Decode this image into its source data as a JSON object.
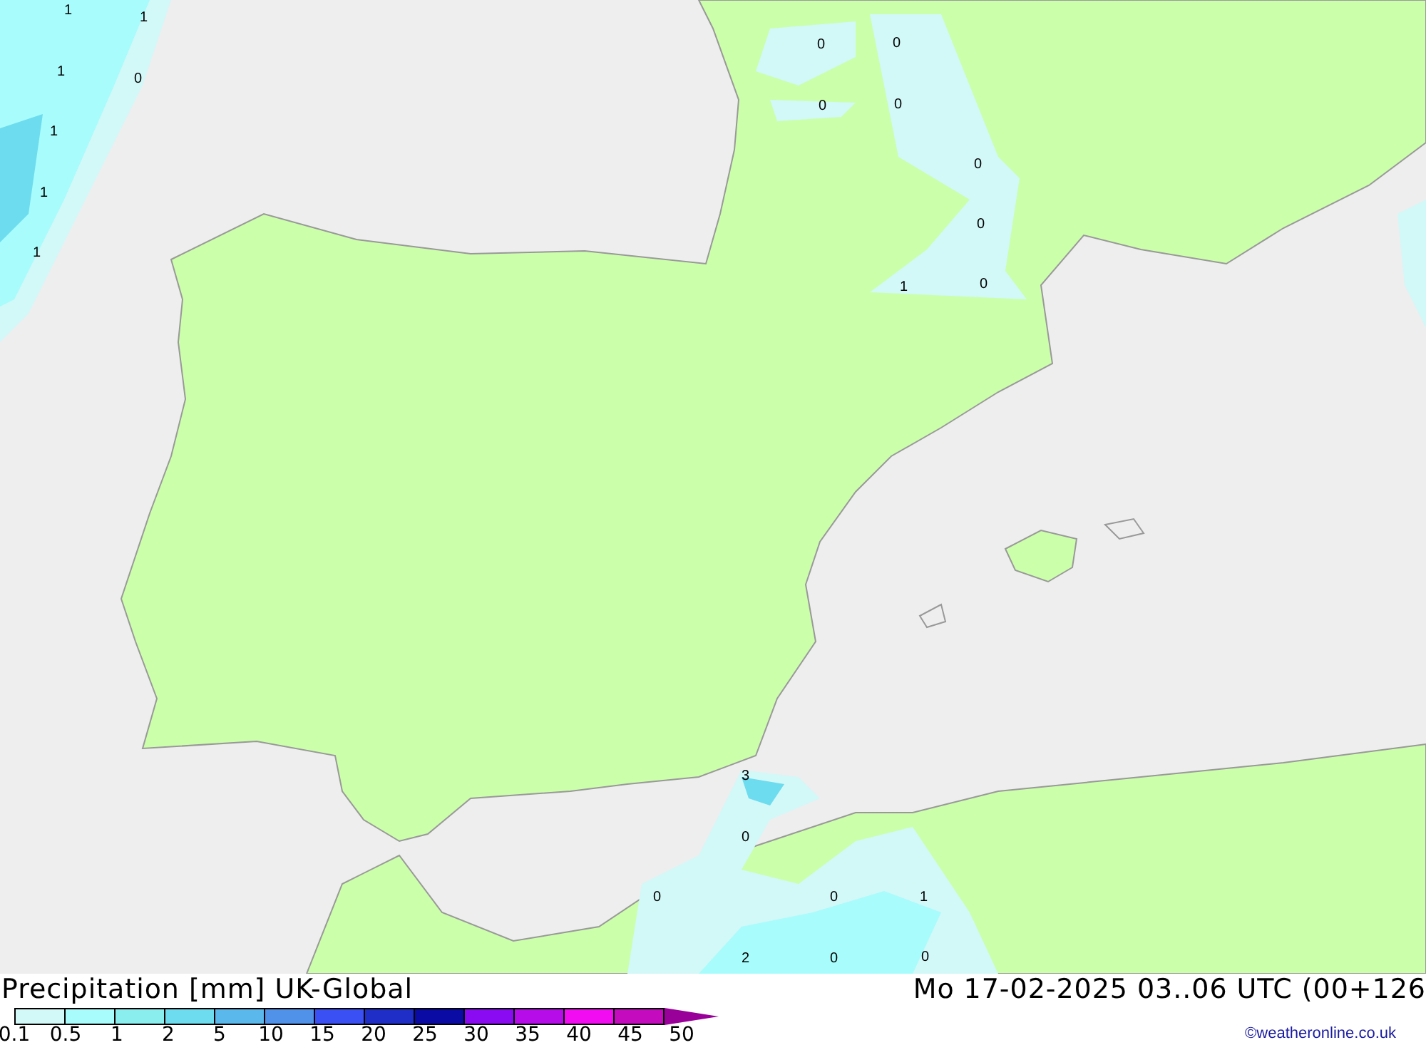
{
  "map": {
    "value_labels": [
      "1",
      "1",
      "1",
      "0",
      "1",
      "1",
      "1",
      "0",
      "0",
      "0",
      "0",
      "0",
      "0",
      "1",
      "0",
      "3",
      "0",
      "0",
      "0",
      "1",
      "2",
      "0",
      "0"
    ]
  },
  "footer": {
    "title": "Precipitation [mm] UK-Global",
    "valid_time": "Mo 17-02-2025 03..06 UTC (00+126",
    "copyright": "©weatheronline.co.uk"
  },
  "legend": {
    "swatches": [
      {
        "color": "#d2f8f8"
      },
      {
        "color": "#a8fcfc"
      },
      {
        "color": "#8aeeee"
      },
      {
        "color": "#6cdcee"
      },
      {
        "color": "#5ab8ec"
      },
      {
        "color": "#5092ea"
      },
      {
        "color": "#3a50f4"
      },
      {
        "color": "#1e2ec6"
      },
      {
        "color": "#0a0aa4"
      },
      {
        "color": "#8a0af2"
      },
      {
        "color": "#b60cea"
      },
      {
        "color": "#f20cf2"
      },
      {
        "color": "#c40cbe"
      }
    ],
    "arrow": {
      "color": "#990099"
    },
    "ticks": [
      "0.1",
      "0.5",
      "1",
      "2",
      "5",
      "10",
      "15",
      "20",
      "25",
      "30",
      "35",
      "40",
      "45",
      "50"
    ]
  }
}
